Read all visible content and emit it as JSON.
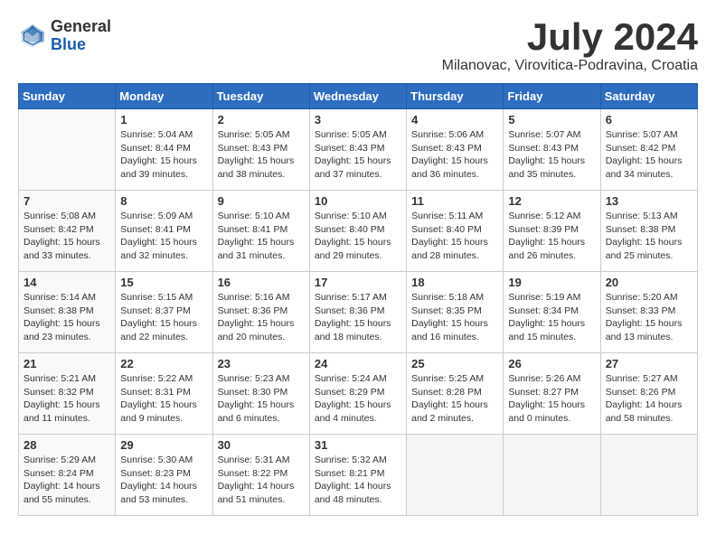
{
  "logo": {
    "general": "General",
    "blue": "Blue"
  },
  "title": {
    "month": "July 2024",
    "location": "Milanovac, Virovitica-Podravina, Croatia"
  },
  "weekdays": [
    "Sunday",
    "Monday",
    "Tuesday",
    "Wednesday",
    "Thursday",
    "Friday",
    "Saturday"
  ],
  "weeks": [
    [
      {
        "day": "",
        "detail": ""
      },
      {
        "day": "1",
        "detail": "Sunrise: 5:04 AM\nSunset: 8:44 PM\nDaylight: 15 hours\nand 39 minutes."
      },
      {
        "day": "2",
        "detail": "Sunrise: 5:05 AM\nSunset: 8:43 PM\nDaylight: 15 hours\nand 38 minutes."
      },
      {
        "day": "3",
        "detail": "Sunrise: 5:05 AM\nSunset: 8:43 PM\nDaylight: 15 hours\nand 37 minutes."
      },
      {
        "day": "4",
        "detail": "Sunrise: 5:06 AM\nSunset: 8:43 PM\nDaylight: 15 hours\nand 36 minutes."
      },
      {
        "day": "5",
        "detail": "Sunrise: 5:07 AM\nSunset: 8:43 PM\nDaylight: 15 hours\nand 35 minutes."
      },
      {
        "day": "6",
        "detail": "Sunrise: 5:07 AM\nSunset: 8:42 PM\nDaylight: 15 hours\nand 34 minutes."
      }
    ],
    [
      {
        "day": "7",
        "detail": "Sunrise: 5:08 AM\nSunset: 8:42 PM\nDaylight: 15 hours\nand 33 minutes."
      },
      {
        "day": "8",
        "detail": "Sunrise: 5:09 AM\nSunset: 8:41 PM\nDaylight: 15 hours\nand 32 minutes."
      },
      {
        "day": "9",
        "detail": "Sunrise: 5:10 AM\nSunset: 8:41 PM\nDaylight: 15 hours\nand 31 minutes."
      },
      {
        "day": "10",
        "detail": "Sunrise: 5:10 AM\nSunset: 8:40 PM\nDaylight: 15 hours\nand 29 minutes."
      },
      {
        "day": "11",
        "detail": "Sunrise: 5:11 AM\nSunset: 8:40 PM\nDaylight: 15 hours\nand 28 minutes."
      },
      {
        "day": "12",
        "detail": "Sunrise: 5:12 AM\nSunset: 8:39 PM\nDaylight: 15 hours\nand 26 minutes."
      },
      {
        "day": "13",
        "detail": "Sunrise: 5:13 AM\nSunset: 8:38 PM\nDaylight: 15 hours\nand 25 minutes."
      }
    ],
    [
      {
        "day": "14",
        "detail": "Sunrise: 5:14 AM\nSunset: 8:38 PM\nDaylight: 15 hours\nand 23 minutes."
      },
      {
        "day": "15",
        "detail": "Sunrise: 5:15 AM\nSunset: 8:37 PM\nDaylight: 15 hours\nand 22 minutes."
      },
      {
        "day": "16",
        "detail": "Sunrise: 5:16 AM\nSunset: 8:36 PM\nDaylight: 15 hours\nand 20 minutes."
      },
      {
        "day": "17",
        "detail": "Sunrise: 5:17 AM\nSunset: 8:36 PM\nDaylight: 15 hours\nand 18 minutes."
      },
      {
        "day": "18",
        "detail": "Sunrise: 5:18 AM\nSunset: 8:35 PM\nDaylight: 15 hours\nand 16 minutes."
      },
      {
        "day": "19",
        "detail": "Sunrise: 5:19 AM\nSunset: 8:34 PM\nDaylight: 15 hours\nand 15 minutes."
      },
      {
        "day": "20",
        "detail": "Sunrise: 5:20 AM\nSunset: 8:33 PM\nDaylight: 15 hours\nand 13 minutes."
      }
    ],
    [
      {
        "day": "21",
        "detail": "Sunrise: 5:21 AM\nSunset: 8:32 PM\nDaylight: 15 hours\nand 11 minutes."
      },
      {
        "day": "22",
        "detail": "Sunrise: 5:22 AM\nSunset: 8:31 PM\nDaylight: 15 hours\nand 9 minutes."
      },
      {
        "day": "23",
        "detail": "Sunrise: 5:23 AM\nSunset: 8:30 PM\nDaylight: 15 hours\nand 6 minutes."
      },
      {
        "day": "24",
        "detail": "Sunrise: 5:24 AM\nSunset: 8:29 PM\nDaylight: 15 hours\nand 4 minutes."
      },
      {
        "day": "25",
        "detail": "Sunrise: 5:25 AM\nSunset: 8:28 PM\nDaylight: 15 hours\nand 2 minutes."
      },
      {
        "day": "26",
        "detail": "Sunrise: 5:26 AM\nSunset: 8:27 PM\nDaylight: 15 hours\nand 0 minutes."
      },
      {
        "day": "27",
        "detail": "Sunrise: 5:27 AM\nSunset: 8:26 PM\nDaylight: 14 hours\nand 58 minutes."
      }
    ],
    [
      {
        "day": "28",
        "detail": "Sunrise: 5:29 AM\nSunset: 8:24 PM\nDaylight: 14 hours\nand 55 minutes."
      },
      {
        "day": "29",
        "detail": "Sunrise: 5:30 AM\nSunset: 8:23 PM\nDaylight: 14 hours\nand 53 minutes."
      },
      {
        "day": "30",
        "detail": "Sunrise: 5:31 AM\nSunset: 8:22 PM\nDaylight: 14 hours\nand 51 minutes."
      },
      {
        "day": "31",
        "detail": "Sunrise: 5:32 AM\nSunset: 8:21 PM\nDaylight: 14 hours\nand 48 minutes."
      },
      {
        "day": "",
        "detail": ""
      },
      {
        "day": "",
        "detail": ""
      },
      {
        "day": "",
        "detail": ""
      }
    ]
  ]
}
